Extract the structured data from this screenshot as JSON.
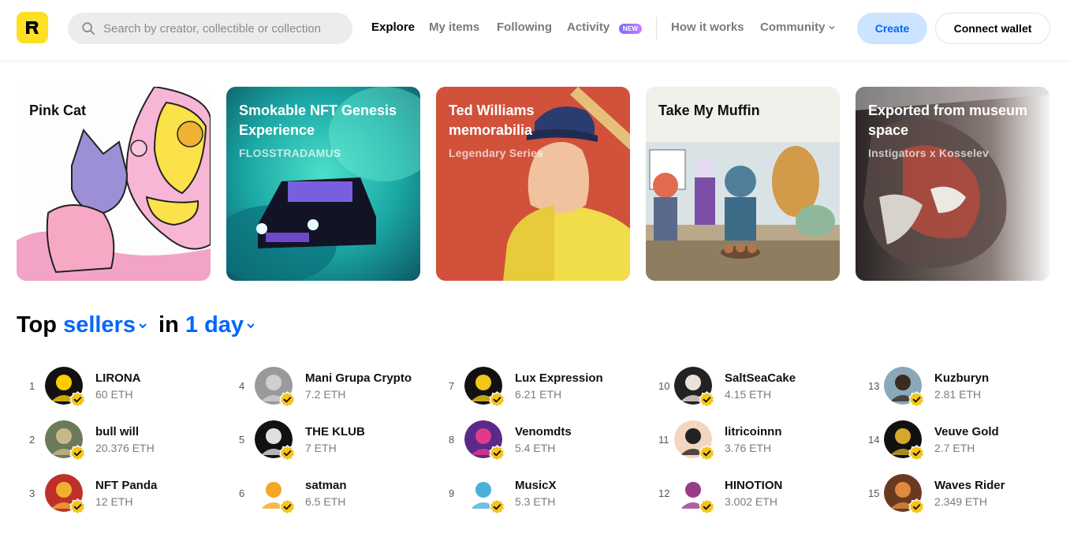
{
  "header": {
    "search_placeholder": "Search by creator, collectible or collection",
    "nav": {
      "explore": "Explore",
      "my_items": "My items",
      "following": "Following",
      "activity": "Activity",
      "activity_badge": "NEW",
      "how_it_works": "How it works",
      "community": "Community"
    },
    "create_label": "Create",
    "connect_label": "Connect wallet"
  },
  "cards": [
    {
      "title": "Pink Cat",
      "subtitle": ""
    },
    {
      "title": "Smokable NFT Genesis Experience",
      "subtitle": "FLOSSTRADAMUS"
    },
    {
      "title": "Ted Williams memorabilia",
      "subtitle": "Legendary Series"
    },
    {
      "title": "Take My Muffin",
      "subtitle": ""
    },
    {
      "title": "Exported from museum space",
      "subtitle": "Instigators x Kosselev"
    }
  ],
  "top_sellers": {
    "prefix": "Top",
    "type": "sellers",
    "connector": "in",
    "period": "1 day",
    "sellers": [
      {
        "rank": "1",
        "name": "LIRONA",
        "eth": "60 ETH"
      },
      {
        "rank": "2",
        "name": "bull will",
        "eth": "20.376 ETH"
      },
      {
        "rank": "3",
        "name": "NFT Panda",
        "eth": "12 ETH"
      },
      {
        "rank": "4",
        "name": "Mani Grupa Crypto",
        "eth": "7.2 ETH"
      },
      {
        "rank": "5",
        "name": "THE KLUB",
        "eth": "7 ETH"
      },
      {
        "rank": "6",
        "name": "satman",
        "eth": "6.5 ETH"
      },
      {
        "rank": "7",
        "name": "Lux Expression",
        "eth": "6.21 ETH"
      },
      {
        "rank": "8",
        "name": "Venomdts",
        "eth": "5.4 ETH"
      },
      {
        "rank": "9",
        "name": "MusicX",
        "eth": "5.3 ETH"
      },
      {
        "rank": "10",
        "name": "SaltSeaCake",
        "eth": "4.15 ETH"
      },
      {
        "rank": "11",
        "name": "litricoinnn",
        "eth": "3.76 ETH"
      },
      {
        "rank": "12",
        "name": "HINOTION",
        "eth": "3.002 ETH"
      },
      {
        "rank": "13",
        "name": "Kuzburyn",
        "eth": "2.81 ETH"
      },
      {
        "rank": "14",
        "name": "Veuve Gold",
        "eth": "2.7 ETH"
      },
      {
        "rank": "15",
        "name": "Waves Rider",
        "eth": "2.349 ETH"
      }
    ]
  },
  "colors": {
    "accent": "#0066ff",
    "logo_yellow": "#fde023",
    "verified_yellow": "#f5c518",
    "create_bg": "#cce4ff"
  },
  "icons": [
    "rarible-logo-icon",
    "search-icon",
    "chevron-down-icon",
    "verified-badge-icon"
  ]
}
